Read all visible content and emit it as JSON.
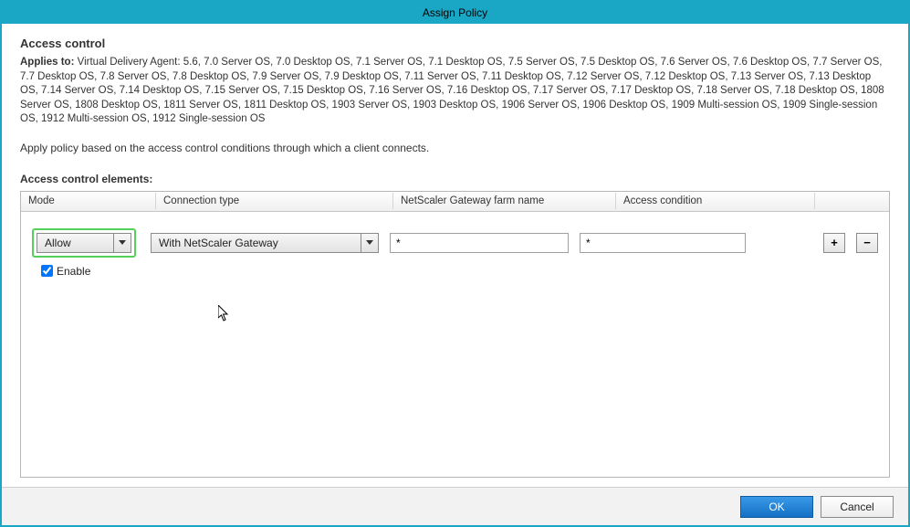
{
  "title": "Assign Policy",
  "section": {
    "heading": "Access control",
    "applies_label": "Applies to:",
    "applies_text": "Virtual Delivery Agent: 5.6, 7.0 Server OS, 7.0 Desktop OS, 7.1 Server OS, 7.1 Desktop OS, 7.5 Server OS, 7.5 Desktop OS, 7.6 Server OS, 7.6 Desktop OS, 7.7 Server OS, 7.7 Desktop OS, 7.8 Server OS, 7.8 Desktop OS, 7.9 Server OS, 7.9 Desktop OS, 7.11 Server OS, 7.11 Desktop OS, 7.12 Server OS, 7.12 Desktop OS, 7.13 Server OS, 7.13 Desktop OS, 7.14 Server OS, 7.14 Desktop OS, 7.15 Server OS, 7.15 Desktop OS, 7.16 Server OS, 7.16 Desktop OS, 7.17 Server OS, 7.17 Desktop OS, 7.18 Server OS, 7.18 Desktop OS, 1808 Server OS, 1808 Desktop OS, 1811 Server OS, 1811 Desktop OS, 1903 Server OS, 1903 Desktop OS, 1906 Server OS, 1906 Desktop OS, 1909 Multi-session OS, 1909 Single-session OS, 1912 Multi-session OS, 1912 Single-session OS",
    "apply_desc": "Apply policy based on the access control conditions through which a client connects.",
    "elements_label": "Access control elements:"
  },
  "table": {
    "headers": {
      "mode": "Mode",
      "connection": "Connection type",
      "farm": "NetScaler Gateway farm name",
      "condition": "Access condition"
    },
    "row": {
      "mode": "Allow",
      "connection": "With NetScaler Gateway",
      "farm": "*",
      "condition": "*",
      "enable_label": "Enable",
      "enable_checked": true
    },
    "buttons": {
      "add": "+",
      "remove": "−"
    }
  },
  "footer": {
    "ok": "OK",
    "cancel": "Cancel"
  }
}
